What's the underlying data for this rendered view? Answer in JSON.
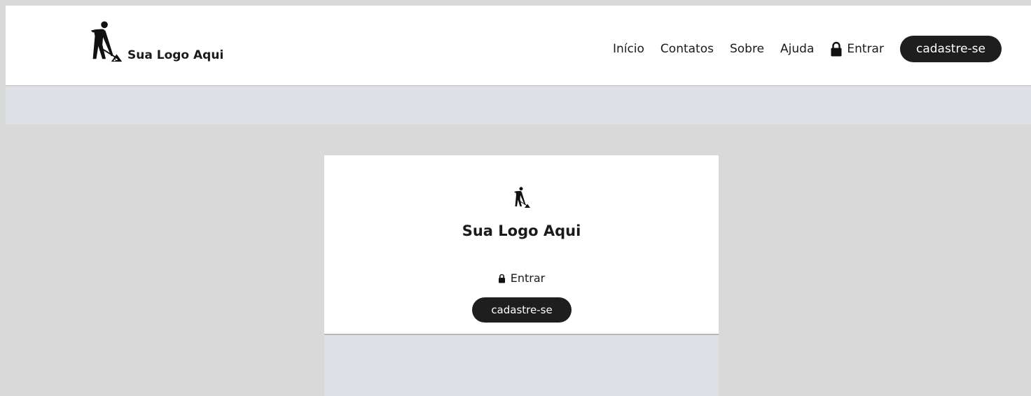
{
  "brand": {
    "name": "Sua Logo Aqui",
    "icon": "construction-worker-icon"
  },
  "nav": {
    "items": [
      {
        "label": "Início"
      },
      {
        "label": "Contatos"
      },
      {
        "label": "Sobre"
      },
      {
        "label": "Ajuda"
      }
    ],
    "login_label": "Entrar",
    "login_icon": "lock-icon",
    "signup_label": "cadastre-se"
  },
  "mobile": {
    "brand_name": "Sua Logo Aqui",
    "login_label": "Entrar",
    "signup_label": "cadastre-se"
  },
  "colors": {
    "page_background": "#d9d9d9",
    "header_background": "#ffffff",
    "content_background": "#dde0e4",
    "button_background": "#1e1e1e",
    "button_text": "#ffffff"
  }
}
